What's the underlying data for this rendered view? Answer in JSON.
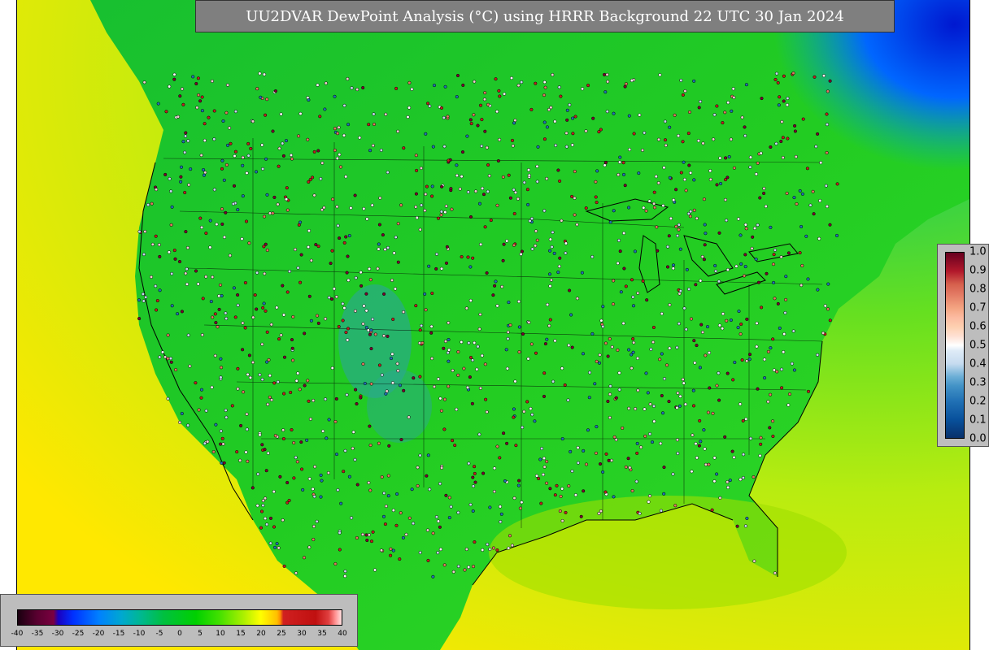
{
  "title": "UU2DVAR DewPoint Analysis (°C) using HRRR Background 22 UTC 30 Jan 2024",
  "temperature_colorbar": {
    "ticks": [
      "-40",
      "-35",
      "-30",
      "-25",
      "-20",
      "-15",
      "-10",
      "-5",
      "0",
      "5",
      "10",
      "15",
      "20",
      "25",
      "30",
      "35",
      "40"
    ],
    "min": -40,
    "max": 40
  },
  "qc_colorbar": {
    "ticks": [
      "1.0",
      "0.9",
      "0.8",
      "0.7",
      "0.6",
      "0.5",
      "0.4",
      "0.3",
      "0.2",
      "0.1",
      "0.0"
    ],
    "min": 0.0,
    "max": 1.0
  },
  "colors": {
    "ocean_warm": "#e6f000",
    "land_mild": "#22cc22",
    "cold_northeast": "#0044ff",
    "cool_rockies": "#22aa99",
    "title_bg": "#7f7f7f",
    "legend_bg": "#bdbdbd"
  }
}
